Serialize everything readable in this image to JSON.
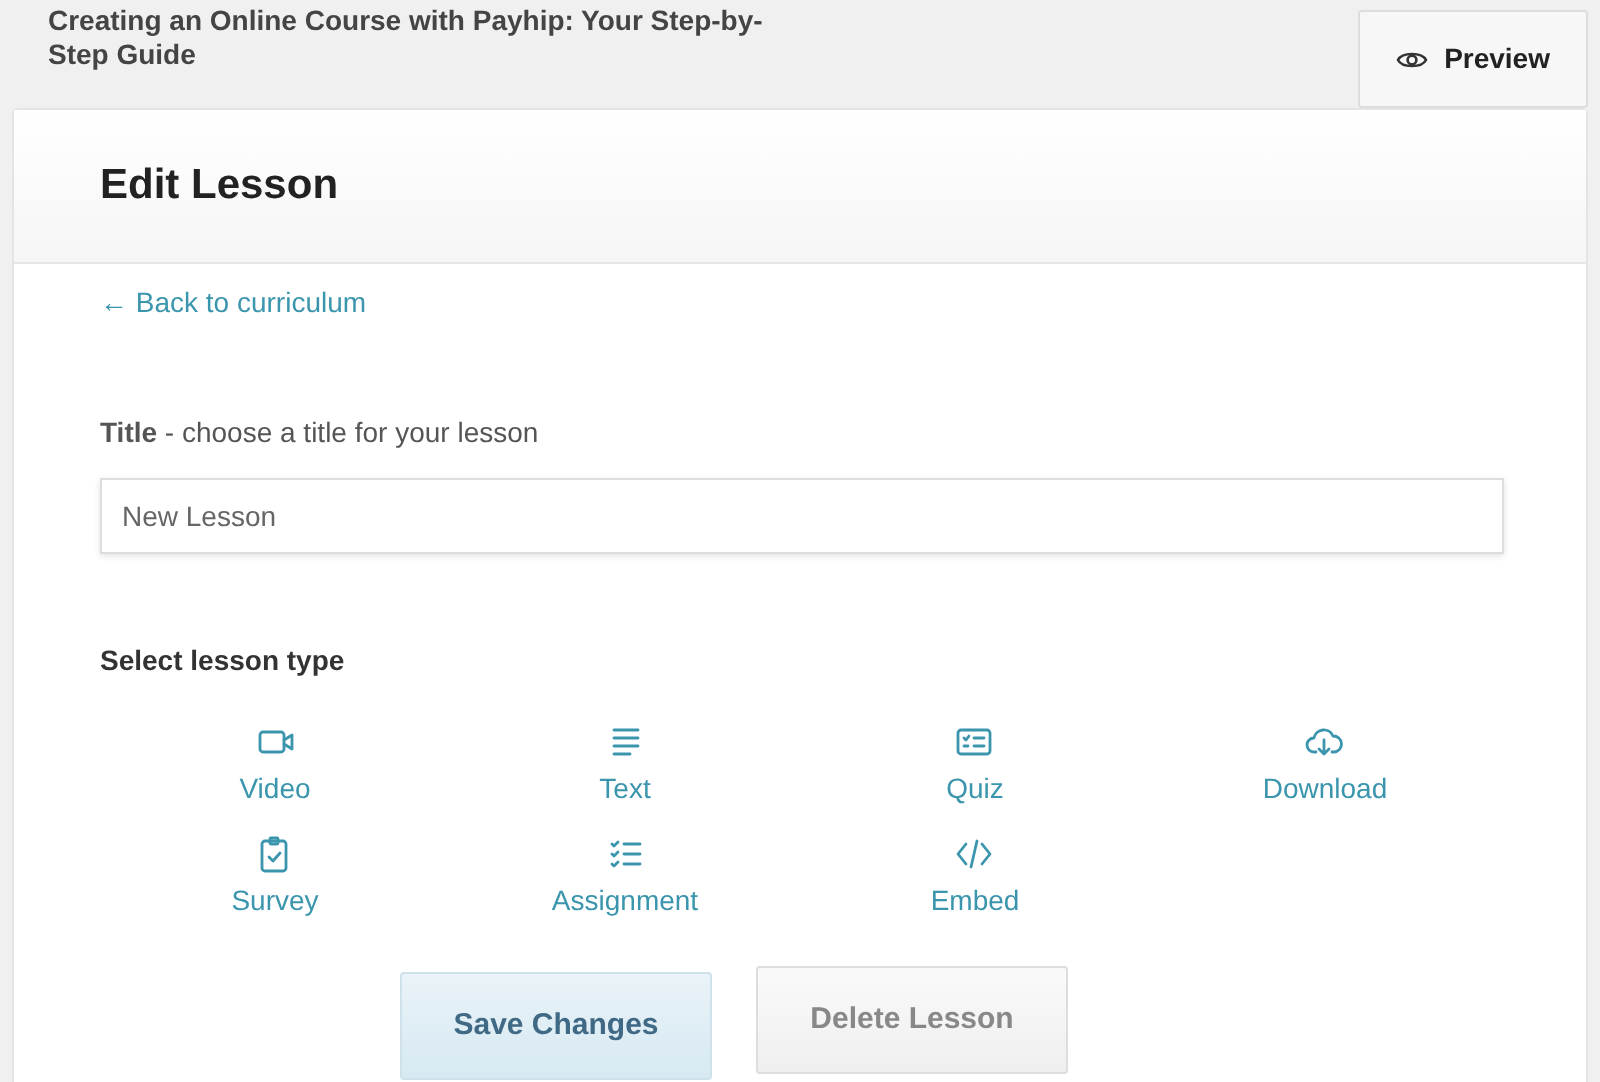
{
  "course_title": "Creating an Online Course with Payhip: Your Step-by-Step Guide",
  "preview_button": "Preview",
  "card_title": "Edit Lesson",
  "back_link": "← Back to curriculum",
  "title_field": {
    "label": "**Title** - choose a title for your lesson",
    "value": "New Lesson"
  },
  "lesson_type_heading": "Select lesson type",
  "lesson_types": [
    {
      "kind": "video",
      "label": "Video"
    },
    {
      "kind": "text",
      "label": "Text"
    },
    {
      "kind": "quiz",
      "label": "Quiz"
    },
    {
      "kind": "download",
      "label": "Download"
    },
    {
      "kind": "survey",
      "label": "Survey"
    },
    {
      "kind": "assignment",
      "label": "Assignment"
    },
    {
      "kind": "embed",
      "label": "Embed"
    }
  ],
  "buttons": [
    {
      "kind": "primary",
      "label": "Save Changes"
    },
    {
      "kind": "secondary",
      "label": "Delete Lesson"
    }
  ]
}
